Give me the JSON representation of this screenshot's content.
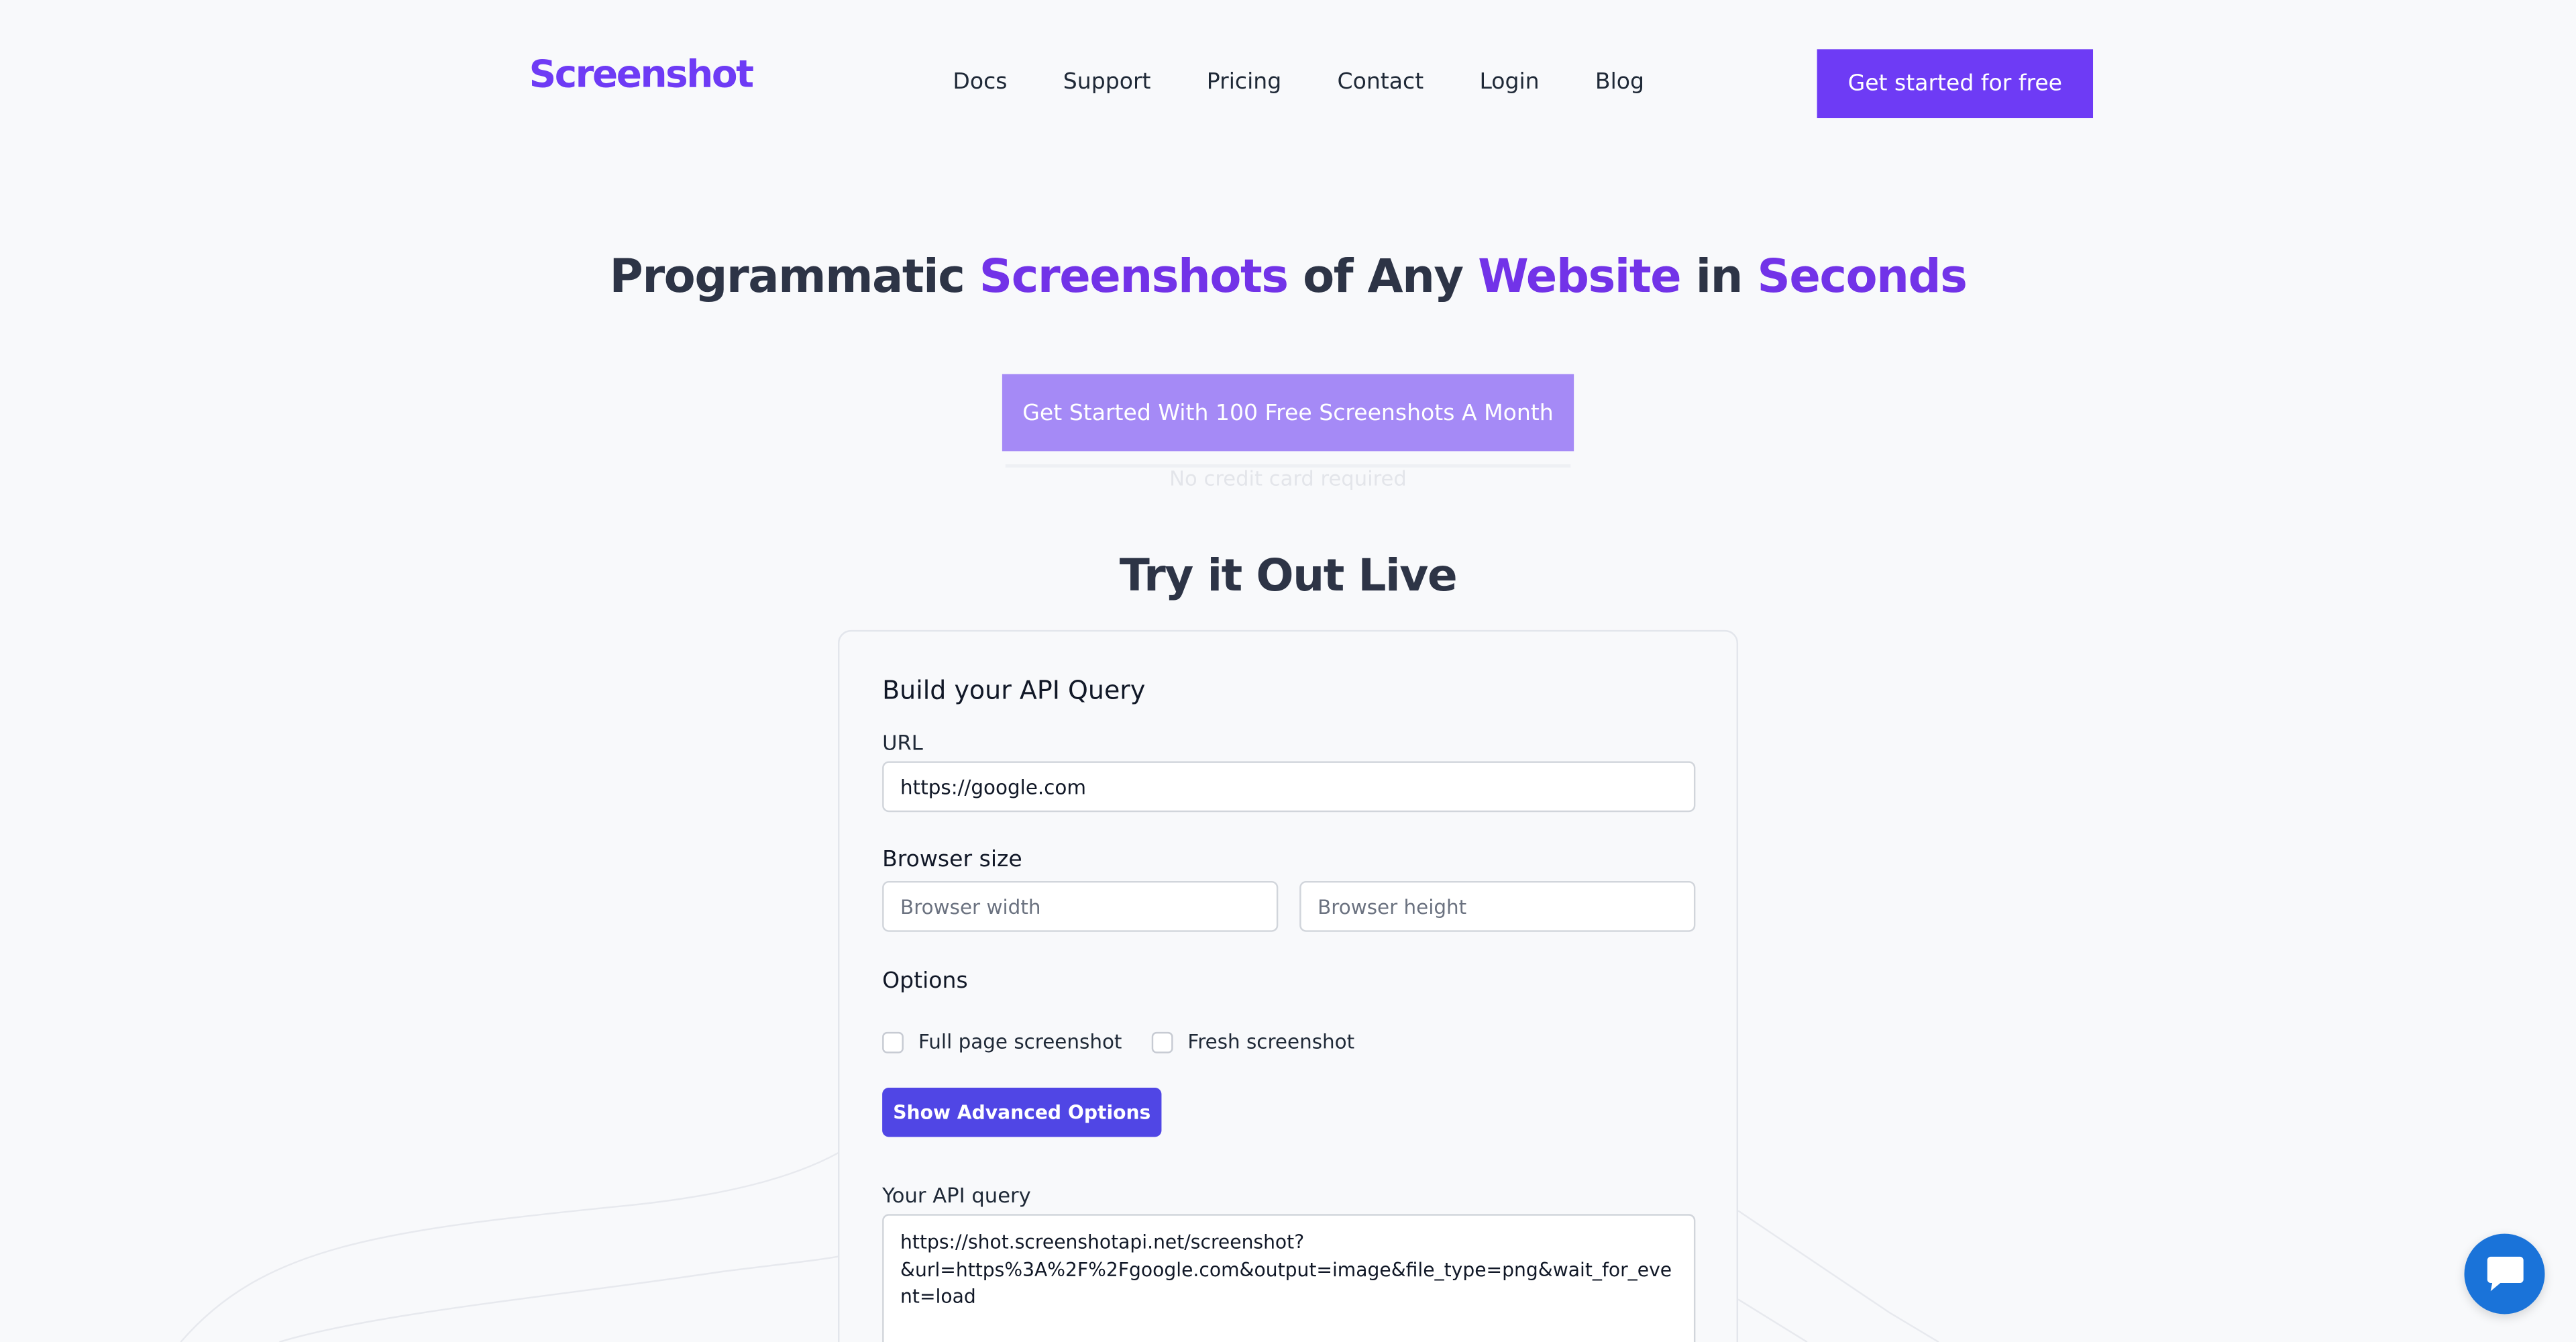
{
  "header": {
    "logo_text": "Screenshot",
    "nav": [
      "Docs",
      "Support",
      "Pricing",
      "Contact",
      "Login",
      "Blog"
    ],
    "cta": "Get started for free"
  },
  "hero": {
    "title_parts": [
      {
        "text": "Programmatic ",
        "highlight": false
      },
      {
        "text": "Screenshots",
        "highlight": true
      },
      {
        "text": " of Any ",
        "highlight": false
      },
      {
        "text": "Website",
        "highlight": true
      },
      {
        "text": " in ",
        "highlight": false
      },
      {
        "text": "Seconds",
        "highlight": true
      }
    ],
    "cta": "Get Started With 100 Free Screenshots A Month",
    "subtext": "No credit card required"
  },
  "live": {
    "section_title": "Try it Out Live",
    "card_title": "Build your API Query",
    "url_label": "URL",
    "url_value": "https://google.com",
    "browser_size_label": "Browser size",
    "width_placeholder": "Browser width",
    "height_placeholder": "Browser height",
    "options_label": "Options",
    "options": [
      "Full page screenshot",
      "Fresh screenshot"
    ],
    "advanced_button": "Show Advanced Options",
    "query_label": "Your API query",
    "query_value": "https://shot.screenshotapi.net/screenshot?\n&url=https%3A%2F%2Fgoogle.com&output=image&file_type=png&wait_for_event=load"
  },
  "colors": {
    "brand": "#6e3bf5",
    "highlight": "#7233e8",
    "cta_light": "#a58af6",
    "button": "#5046e5",
    "chat": "#1a73d9"
  },
  "icons": {
    "chat": "chat-bubble-icon"
  }
}
